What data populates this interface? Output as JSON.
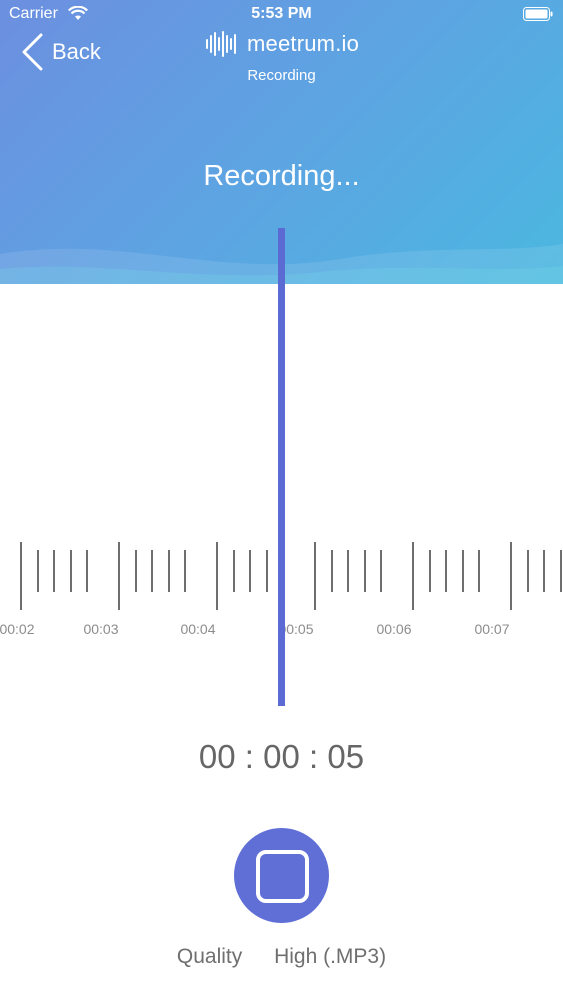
{
  "status_bar": {
    "carrier": "Carrier",
    "time": "5:53 PM"
  },
  "nav": {
    "back_label": "Back",
    "brand_name": "meetrum.io",
    "subtitle": "Recording"
  },
  "recording": {
    "title": "Recording...",
    "timer": "00 : 00 : 05",
    "time_labels": [
      "00:02",
      "00:03",
      "00:04",
      "00:05",
      "00:06",
      "00:07"
    ]
  },
  "settings": {
    "quality_label": "Quality",
    "quality_value": "High (.MP3)"
  },
  "colors": {
    "accent": "#5f6fd6",
    "playhead": "#5b6bd3",
    "header_start": "#6c8fe0",
    "header_end": "#4bb7e0"
  },
  "icons": {
    "back": "chevron-left-icon",
    "logo": "soundwave-icon",
    "stop": "stop-icon",
    "wifi": "wifi-icon",
    "battery": "battery-icon"
  }
}
